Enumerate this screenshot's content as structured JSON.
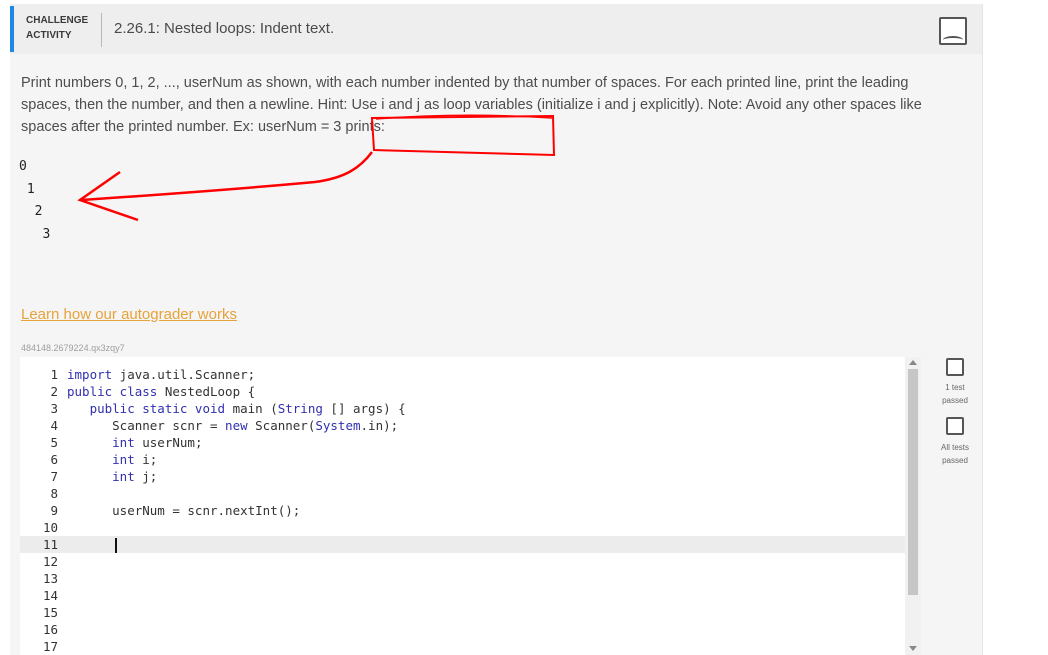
{
  "header": {
    "label": "CHALLENGE\nACTIVITY",
    "title": "2.26.1: Nested loops: Indent text."
  },
  "instructions": "Print numbers 0, 1, 2, ..., userNum as shown, with each number indented by that number of spaces. For each printed line, print the leading spaces, then the number, and then a newline. Hint: Use i and j as loop variables (initialize i and j explicitly). Note: Avoid any other spaces like spaces after the printed number. Ex: userNum = 3 prints:",
  "example_output": [
    "0",
    " 1",
    "  2",
    "   3"
  ],
  "autograder_link": "Learn how our autograder works",
  "activity_id": "484148.2679224.qx3zqy7",
  "editor": {
    "line_numbers": [
      "1",
      "2",
      "3",
      "4",
      "5",
      "6",
      "7",
      "8",
      "9",
      "10",
      "11",
      "12",
      "13",
      "14",
      "15",
      "16",
      "17"
    ],
    "active_line": 11
  },
  "tests": [
    {
      "label": "1 test\npassed"
    },
    {
      "label": "All tests\npassed"
    }
  ],
  "icons": {
    "header_badge": "completion-badge-icon",
    "test_badge": "test-status-icon"
  },
  "colors": {
    "accent": "#1e88e5",
    "link": "#e8a23a",
    "keyword": "#3030b0",
    "annotation": "#ff0000"
  }
}
